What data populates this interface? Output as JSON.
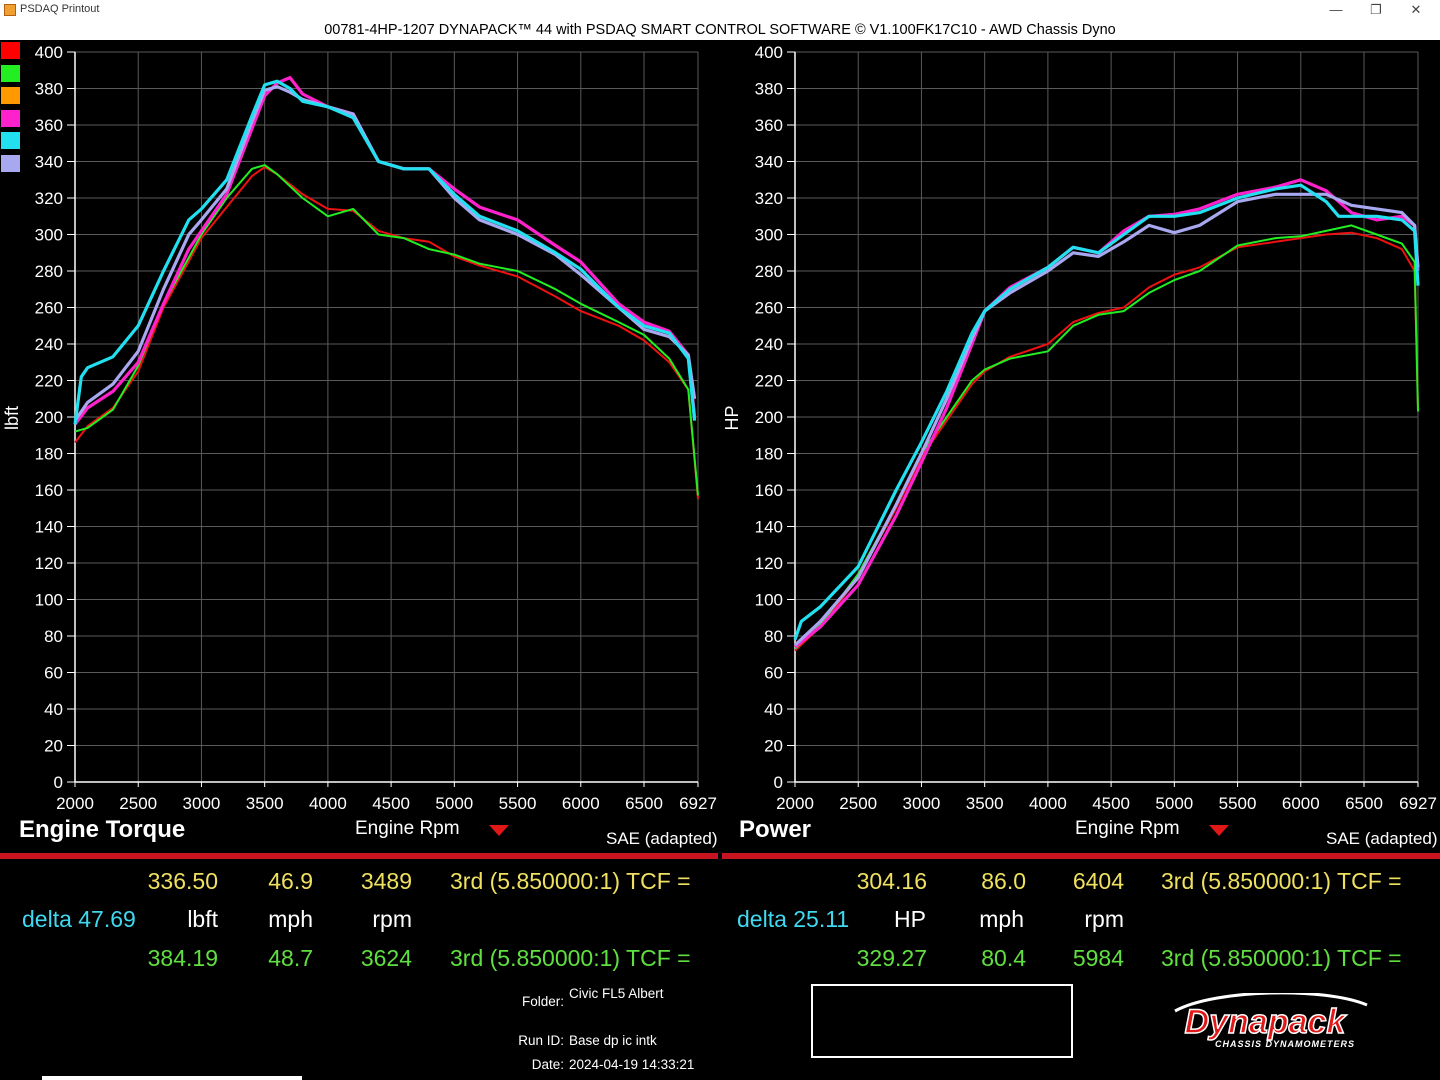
{
  "window": {
    "title": "PSDAQ Printout",
    "min_icon": "minimize-icon",
    "max_icon": "restore-icon",
    "close_icon": "close-icon",
    "min_glyph": "—",
    "max_glyph": "❐",
    "close_glyph": "✕"
  },
  "header": {
    "title": "00781-4HP-1207 DYNAPACK™ 44 with PSDAQ SMART CONTROL SOFTWARE © V1.100FK17C10 - AWD Chassis Dyno"
  },
  "legend_swatches": [
    "#ff0000",
    "#22ee22",
    "#ff9900",
    "#ff22cc",
    "#22e0f0",
    "#a8a8f0"
  ],
  "chart_data": [
    {
      "type": "line",
      "title": "Engine Torque",
      "xlabel": "Engine Rpm",
      "ylabel": "lbft",
      "note": "SAE (adapted)",
      "xlim": [
        2000,
        6927
      ],
      "ylim": [
        0,
        400
      ],
      "xticks": [
        "2000",
        "2500",
        "3000",
        "3500",
        "4000",
        "4500",
        "5000",
        "5500",
        "6000",
        "6500",
        "6927"
      ],
      "yticks": [
        "0",
        "20",
        "40",
        "60",
        "80",
        "100",
        "120",
        "140",
        "160",
        "180",
        "200",
        "220",
        "240",
        "260",
        "280",
        "300",
        "320",
        "340",
        "360",
        "380",
        "400"
      ],
      "grid": true,
      "series": [
        {
          "color": "#ee1111",
          "x": [
            2000,
            2100,
            2300,
            2500,
            2700,
            3000,
            3200,
            3400,
            3500,
            3600,
            3800,
            4000,
            4200,
            4400,
            4600,
            4800,
            5000,
            5200,
            5500,
            5800,
            6000,
            6300,
            6500,
            6700,
            6850,
            6927
          ],
          "y": [
            186,
            195,
            205,
            225,
            260,
            298,
            315,
            332,
            337,
            333,
            322,
            314,
            313,
            302,
            298,
            296,
            288,
            283,
            277,
            266,
            258,
            250,
            242,
            230,
            215,
            155
          ]
        },
        {
          "color": "#22ee22",
          "x": [
            2000,
            2100,
            2300,
            2500,
            2700,
            3000,
            3200,
            3400,
            3500,
            3600,
            3800,
            4000,
            4200,
            4400,
            4600,
            4800,
            5000,
            5200,
            5500,
            5800,
            6000,
            6300,
            6500,
            6700,
            6850,
            6927
          ],
          "y": [
            192,
            194,
            204,
            228,
            262,
            300,
            320,
            336,
            338,
            333,
            320,
            310,
            314,
            300,
            298,
            292,
            289,
            284,
            280,
            270,
            262,
            252,
            245,
            232,
            215,
            157
          ]
        },
        {
          "color": "#ff22cc",
          "x": [
            2000,
            2100,
            2300,
            2500,
            2700,
            2900,
            3000,
            3200,
            3400,
            3500,
            3600,
            3700,
            3800,
            4000,
            4200,
            4400,
            4600,
            4800,
            5000,
            5200,
            5500,
            5800,
            6000,
            6300,
            6500,
            6700,
            6850,
            6900
          ],
          "y": [
            196,
            205,
            214,
            230,
            262,
            292,
            302,
            322,
            358,
            376,
            383,
            386,
            377,
            370,
            366,
            340,
            336,
            336,
            325,
            315,
            308,
            294,
            285,
            262,
            252,
            247,
            234,
            200
          ]
        },
        {
          "color": "#a8a8f0",
          "x": [
            2000,
            2100,
            2300,
            2500,
            2700,
            2900,
            3000,
            3200,
            3400,
            3500,
            3600,
            3700,
            3800,
            4000,
            4200,
            4400,
            4600,
            4800,
            5000,
            5200,
            5500,
            5800,
            6000,
            6300,
            6500,
            6700,
            6850,
            6900
          ],
          "y": [
            198,
            208,
            218,
            236,
            270,
            300,
            308,
            325,
            362,
            379,
            381,
            378,
            374,
            370,
            366,
            340,
            336,
            336,
            320,
            308,
            300,
            289,
            278,
            260,
            248,
            244,
            234,
            210
          ]
        },
        {
          "color": "#22e0f0",
          "x": [
            2000,
            2050,
            2100,
            2300,
            2500,
            2700,
            2900,
            3000,
            3200,
            3400,
            3500,
            3600,
            3700,
            3800,
            4000,
            4200,
            4400,
            4600,
            4800,
            5000,
            5200,
            5500,
            5800,
            6000,
            6300,
            6500,
            6700,
            6850,
            6900
          ],
          "y": [
            196,
            222,
            227,
            233,
            250,
            280,
            308,
            314,
            330,
            365,
            382,
            384,
            380,
            373,
            370,
            364,
            340,
            336,
            336,
            322,
            310,
            302,
            290,
            281,
            260,
            250,
            246,
            232,
            198
          ]
        }
      ]
    },
    {
      "type": "line",
      "title": "Power",
      "xlabel": "Engine Rpm",
      "ylabel": "HP",
      "note": "SAE (adapted)",
      "xlim": [
        2000,
        6927
      ],
      "ylim": [
        0,
        400
      ],
      "xticks": [
        "2000",
        "2500",
        "3000",
        "3500",
        "4000",
        "4500",
        "5000",
        "5500",
        "6000",
        "6500",
        "6927"
      ],
      "yticks": [
        "0",
        "20",
        "40",
        "60",
        "80",
        "100",
        "120",
        "140",
        "160",
        "180",
        "200",
        "220",
        "240",
        "260",
        "280",
        "300",
        "320",
        "340",
        "360",
        "380",
        "400"
      ],
      "grid": true,
      "series": [
        {
          "color": "#ee1111",
          "x": [
            2000,
            2200,
            2500,
            2800,
            3000,
            3200,
            3400,
            3500,
            3700,
            4000,
            4200,
            4400,
            4600,
            4800,
            5000,
            5200,
            5500,
            5800,
            6000,
            6200,
            6400,
            6600,
            6800,
            6900,
            6927
          ],
          "y": [
            72,
            85,
            112,
            150,
            178,
            198,
            218,
            225,
            233,
            240,
            252,
            257,
            260,
            271,
            278,
            282,
            293,
            296,
            298,
            300,
            301,
            298,
            292,
            280,
            205
          ]
        },
        {
          "color": "#22ee22",
          "x": [
            2000,
            2200,
            2500,
            2800,
            3000,
            3200,
            3400,
            3500,
            3700,
            4000,
            4200,
            4400,
            4600,
            4800,
            5000,
            5200,
            5500,
            5800,
            6000,
            6200,
            6400,
            6600,
            6800,
            6900,
            6927
          ],
          "y": [
            73,
            86,
            114,
            152,
            180,
            200,
            220,
            226,
            232,
            236,
            250,
            256,
            258,
            268,
            275,
            280,
            294,
            298,
            299,
            302,
            305,
            300,
            295,
            285,
            203
          ]
        },
        {
          "color": "#ff22cc",
          "x": [
            2000,
            2200,
            2500,
            2800,
            3000,
            3200,
            3400,
            3500,
            3700,
            4000,
            4200,
            4400,
            4600,
            4800,
            5000,
            5200,
            5500,
            5800,
            6000,
            6200,
            6400,
            6600,
            6800,
            6900,
            6927
          ],
          "y": [
            74,
            85,
            108,
            146,
            175,
            205,
            240,
            258,
            271,
            282,
            293,
            290,
            302,
            310,
            311,
            314,
            322,
            326,
            330,
            324,
            312,
            308,
            310,
            305,
            280
          ]
        },
        {
          "color": "#a8a8f0",
          "x": [
            2000,
            2200,
            2500,
            2800,
            3000,
            3200,
            3400,
            3500,
            3700,
            4000,
            4200,
            4400,
            4600,
            4800,
            5000,
            5200,
            5500,
            5800,
            6000,
            6200,
            6400,
            6600,
            6800,
            6900,
            6927
          ],
          "y": [
            75,
            88,
            112,
            152,
            180,
            210,
            243,
            258,
            268,
            280,
            290,
            288,
            296,
            305,
            301,
            305,
            318,
            322,
            322,
            322,
            316,
            314,
            312,
            305,
            282
          ]
        },
        {
          "color": "#22e0f0",
          "x": [
            2000,
            2050,
            2200,
            2500,
            2800,
            3000,
            3200,
            3400,
            3500,
            3700,
            4000,
            4200,
            4400,
            4600,
            4800,
            5000,
            5200,
            5500,
            5800,
            6000,
            6200,
            6300,
            6400,
            6600,
            6800,
            6900,
            6927
          ],
          "y": [
            78,
            88,
            96,
            118,
            160,
            186,
            214,
            246,
            258,
            270,
            282,
            293,
            290,
            300,
            310,
            310,
            312,
            320,
            325,
            327,
            318,
            310,
            310,
            310,
            308,
            302,
            272
          ]
        }
      ]
    }
  ],
  "left_readout": {
    "top": {
      "torque": "336.50",
      "speed": "46.9",
      "rpm": "3489",
      "gear": "3rd (5.850000:1) TCF ="
    },
    "units": {
      "delta": "delta 47.69",
      "torque": "lbft",
      "speed": "mph",
      "rpm": "rpm"
    },
    "bottom": {
      "torque": "384.19",
      "speed": "48.7",
      "rpm": "3624",
      "gear": "3rd (5.850000:1) TCF ="
    }
  },
  "right_readout": {
    "top": {
      "power": "304.16",
      "speed": "86.0",
      "rpm": "6404",
      "gear": "3rd (5.850000:1) TCF ="
    },
    "units": {
      "delta": "delta 25.11",
      "power": "HP",
      "speed": "mph",
      "rpm": "rpm"
    },
    "bottom": {
      "power": "329.27",
      "speed": "80.4",
      "rpm": "5984",
      "gear": "3rd (5.850000:1) TCF ="
    }
  },
  "run_info": {
    "folder_label": "Folder:",
    "folder": "Civic FL5 Albert",
    "run_label": "Run ID:",
    "run": "Base dp ic intk",
    "date_label": "Date:",
    "date": "2024-04-19 14:33:21"
  },
  "logo": {
    "brand": "Dynapack",
    "sub": "CHASSIS DYNAMOMETERS",
    "icon": "dynapack-logo"
  }
}
